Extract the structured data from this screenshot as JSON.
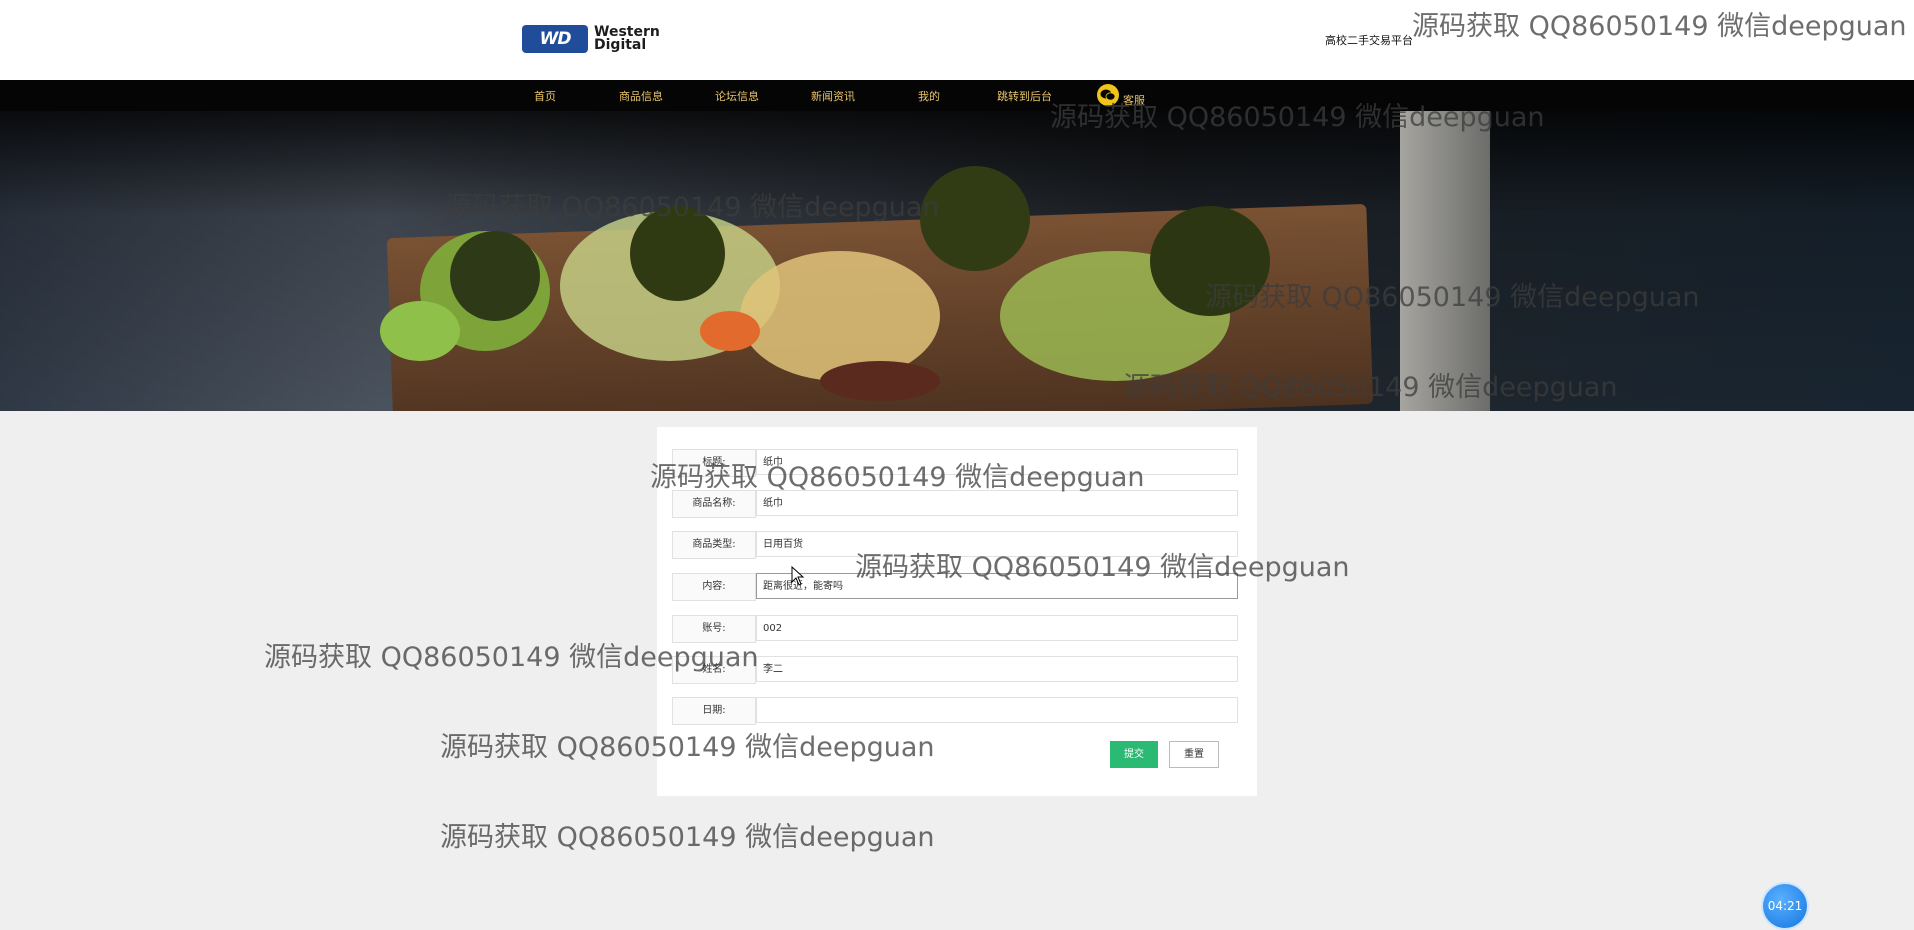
{
  "header": {
    "logo_mark": "WD",
    "logo_line1": "Western",
    "logo_line2": "Digital",
    "platform_name": "高校二手交易平台"
  },
  "nav": {
    "items": [
      {
        "label": "首页"
      },
      {
        "label": "商品信息"
      },
      {
        "label": "论坛信息"
      },
      {
        "label": "新闻资讯"
      },
      {
        "label": "我的"
      },
      {
        "label": "跳转到后台"
      },
      {
        "label": "客服"
      }
    ],
    "icon": "wechat-icon"
  },
  "form": {
    "fields": [
      {
        "label": "标题:",
        "value": "纸巾"
      },
      {
        "label": "商品名称:",
        "value": "纸巾"
      },
      {
        "label": "商品类型:",
        "value": "日用百货"
      },
      {
        "label": "内容:",
        "value": "距离很近，能寄吗"
      },
      {
        "label": "账号:",
        "value": "002"
      },
      {
        "label": "姓名:",
        "value": "李二"
      },
      {
        "label": "日期:",
        "value": ""
      }
    ],
    "submit_label": "提交",
    "reset_label": "重置"
  },
  "watermark_text": "源码获取 QQ86050149 微信deepguan",
  "timer": "04:21",
  "colors": {
    "nav_bg": "#050505",
    "nav_text": "#e9c46a",
    "submit_bg": "#2bba73",
    "page_bg": "#efefef",
    "timer_bg": "#1476e0"
  }
}
